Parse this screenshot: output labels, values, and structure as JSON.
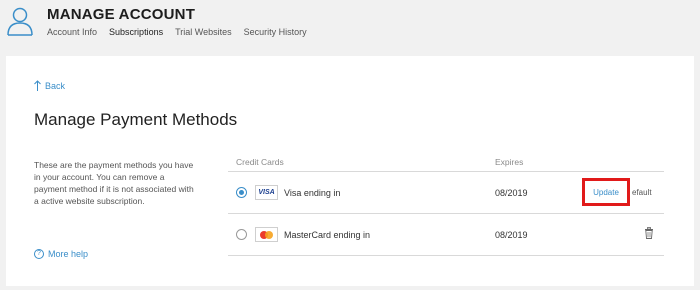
{
  "header": {
    "title": "MANAGE ACCOUNT",
    "nav": [
      {
        "label": "Account Info"
      },
      {
        "label": "Subscriptions"
      },
      {
        "label": "Trial Websites"
      },
      {
        "label": "Security History"
      }
    ],
    "active_tab": "Subscriptions"
  },
  "page": {
    "back_label": "Back",
    "title": "Manage Payment Methods",
    "description": "These are the payment methods you have in your account. You can remove a payment method if it is not associated with a active website subscription.",
    "more_help": "More help"
  },
  "payments": {
    "col_card": "Credit Cards",
    "col_expires": "Expires",
    "rows": [
      {
        "brand_icon": "visa-icon",
        "brand_text": "VISA",
        "label": "Visa ending in",
        "expires": "08/2019",
        "selected": true,
        "action": "Update",
        "action_tail": "efault"
      },
      {
        "brand_icon": "mastercard-icon",
        "label": "MasterCard ending in",
        "expires": "08/2019",
        "selected": false,
        "action_icon": "trash-icon"
      }
    ]
  },
  "colors": {
    "accent": "#3a8ec9",
    "highlight": "#e11a1a",
    "background": "#f1f1f1",
    "card": "#ffffff"
  }
}
